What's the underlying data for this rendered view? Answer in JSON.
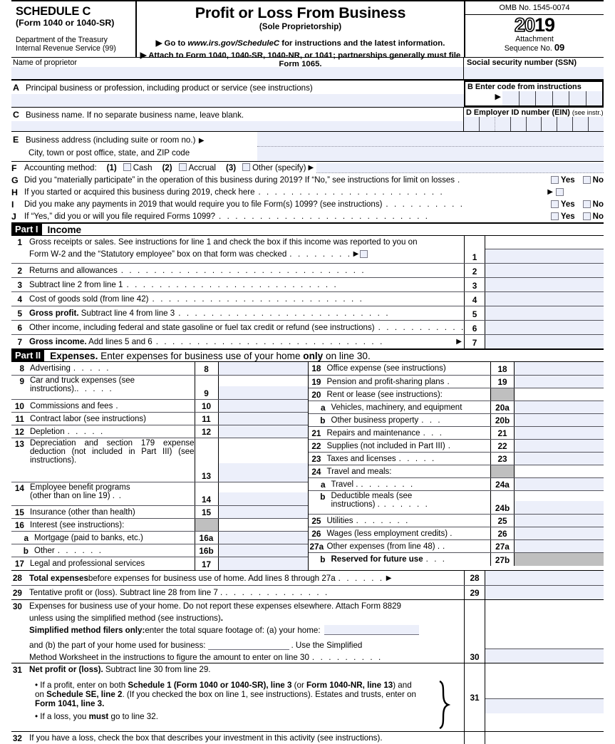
{
  "header": {
    "schedule": "SCHEDULE C",
    "schedule_sub": "(Form 1040 or 1040-SR)",
    "dept_line1": "Department of the Treasury",
    "dept_line2": "Internal Revenue Service (99)",
    "title": "Profit or Loss From Business",
    "subtitle": "(Sole Proprietorship)",
    "goto_prefix": "▶ Go to ",
    "goto_url": "www.irs.gov/ScheduleC",
    "goto_suffix": " for instructions and the latest information.",
    "attach": "▶ Attach to Form 1040, 1040-SR, 1040-NR, or 1041; partnerships generally must file Form 1065.",
    "omb": "OMB No. 1545-0074",
    "year_hollow": "20",
    "year_bold": "19",
    "attachment_label": "Attachment",
    "sequence_label": "Sequence No.",
    "sequence_no": "09"
  },
  "identity": {
    "name_label": "Name of proprietor",
    "name_value": "",
    "ssn_label": "Social security number (SSN)",
    "ssn_value": "",
    "a_letter": "A",
    "a_label": "Principal business or profession, including product or service (see instructions)",
    "a_value": "",
    "b_letter": "B",
    "b_label": "Enter code from instructions",
    "b_cells": 6,
    "c_letter": "C",
    "c_label": "Business name. If no separate business name, leave blank.",
    "c_value": "",
    "d_letter": "D",
    "d_label": "Employer ID number (EIN)",
    "d_label_note": "(see instr.)",
    "d_cells": 9,
    "e_letter": "E",
    "e_label": "Business address (including suite or room no.)",
    "e_value": "",
    "e_label2": "City, town or post office, state, and ZIP code",
    "e_value2": ""
  },
  "questions": {
    "f_letter": "F",
    "f_label": "Accounting method:",
    "f_options": [
      {
        "num": "(1)",
        "label": "Cash"
      },
      {
        "num": "(2)",
        "label": "Accrual"
      },
      {
        "num": "(3)",
        "label": "Other (specify)"
      }
    ],
    "f_other_value": "",
    "g_letter": "G",
    "g_text": "Did you “materially participate” in the operation of this business during 2019? If “No,” see instructions for limit on losses",
    "h_letter": "H",
    "h_text": "If you started or acquired this business during 2019, check here",
    "i_letter": "I",
    "i_text": "Did you make any payments in 2019 that would require you to file Form(s) 1099? (see instructions)",
    "j_letter": "J",
    "j_text": "If “Yes,” did you or will you file required Forms 1099?",
    "yes_label": "Yes",
    "no_label": "No"
  },
  "part1": {
    "part_label": "Part I",
    "part_title": "Income",
    "lines": [
      {
        "no": "1",
        "text_plain": "Gross receipts or sales. See instructions for line 1 and check the box if this income was reported to you on",
        "text2": "Form W-2 and the “Statutory employee” box on that form was checked",
        "box_no": "1",
        "amount": ""
      },
      {
        "no": "2",
        "text_plain": "Returns and allowances",
        "box_no": "2",
        "amount": ""
      },
      {
        "no": "3",
        "text_plain": "Subtract line 2 from line 1",
        "box_no": "3",
        "amount": ""
      },
      {
        "no": "4",
        "text_plain": "Cost of goods sold (from line 42)",
        "box_no": "4",
        "amount": ""
      },
      {
        "no": "5",
        "bold": "Gross profit.",
        "text_plain": " Subtract line 4 from line 3",
        "box_no": "5",
        "amount": ""
      },
      {
        "no": "6",
        "text_plain": "Other income, including federal and state gasoline or fuel tax credit or refund (see instructions)",
        "box_no": "6",
        "amount": ""
      },
      {
        "no": "7",
        "bold": "Gross income.",
        "text_plain": " Add lines 5 and 6",
        "box_no": "7",
        "amount": ""
      }
    ]
  },
  "part2": {
    "part_label": "Part II",
    "part_title_bold": "Expenses.",
    "part_title_rest": " Enter expenses for business use of your home ",
    "part_title_only": "only",
    "part_title_end": " on line 30.",
    "left_lines": [
      {
        "no": "8",
        "label": "Advertising",
        "box_no": "8",
        "amount": "",
        "dots": ".  .  .  .  ."
      },
      {
        "no": "9",
        "label": "Car and truck expenses (see",
        "label2": "instructions).",
        "box_no": "9",
        "amount": "",
        "dots": ".  .  .  .  ."
      },
      {
        "no": "10",
        "label": "Commissions and fees",
        "box_no": "10",
        "amount": "",
        "dots": "  ."
      },
      {
        "no": "11",
        "label": "Contract labor (see instructions)",
        "box_no": "11",
        "amount": "",
        "dots": ""
      },
      {
        "no": "12",
        "label": "Depletion",
        "box_no": "12",
        "amount": "",
        "dots": ".  .  .  .  ."
      },
      {
        "no": "13",
        "label": "Depreciation and section 179 expense deduction (not included in Part III) (see instructions).",
        "box_no": "13",
        "amount": "",
        "dots": "  .  .  .  .  ."
      },
      {
        "no": "14",
        "label": "Employee benefit programs",
        "label2": "(other than on line 19) .",
        "box_no": "14",
        "amount": "",
        "dots": "  ."
      },
      {
        "no": "15",
        "label": "Insurance (other than health)",
        "box_no": "15",
        "amount": "",
        "dots": ""
      },
      {
        "no": "16",
        "label": "Interest (see instructions):",
        "box_no": "",
        "shaded": true
      },
      {
        "no": "a",
        "label": "Mortgage (paid to banks, etc.)",
        "box_no": "16a",
        "amount": "",
        "dots": ""
      },
      {
        "no": "b",
        "label": "Other",
        "box_no": "16b",
        "amount": "",
        "dots": ".  .  .  .  .  ."
      },
      {
        "no": "17",
        "label": "Legal and professional services",
        "box_no": "17",
        "amount": "",
        "dots": ""
      }
    ],
    "right_lines": [
      {
        "no": "18",
        "label": "Office expense (see instructions)",
        "box_no": "18",
        "amount": "",
        "dots": ""
      },
      {
        "no": "19",
        "label": "Pension and profit-sharing plans",
        "box_no": "19",
        "amount": "",
        "dots": "  ."
      },
      {
        "no": "20",
        "label": "Rent or lease (see instructions):",
        "box_no": "",
        "shaded": true
      },
      {
        "no": "a",
        "label": "Vehicles, machinery, and equipment",
        "box_no": "20a",
        "amount": "",
        "dots": ""
      },
      {
        "no": "b",
        "label": "Other business property",
        "box_no": "20b",
        "amount": "",
        "dots": "  .  .  ."
      },
      {
        "no": "21",
        "label": "Repairs and maintenance",
        "box_no": "21",
        "amount": "",
        "dots": "  .  .  ."
      },
      {
        "no": "22",
        "label": "Supplies (not included in Part III)",
        "box_no": "22",
        "amount": "",
        "dots": "  ."
      },
      {
        "no": "23",
        "label": "Taxes and licenses",
        "box_no": "23",
        "amount": "",
        "dots": ".  .  .  .  ."
      },
      {
        "no": "24",
        "label": "Travel and meals:",
        "box_no": "",
        "shaded": true
      },
      {
        "no": "a",
        "label": "Travel .",
        "box_no": "24a",
        "amount": "",
        "dots": "  .  .  .  .  .  .  ."
      },
      {
        "no": "b",
        "label": "Deductible meals (see",
        "label2": "instructions) .",
        "box_no": "24b",
        "amount": "",
        "dots": "  .  .  .  .  .  ."
      },
      {
        "no": "25",
        "label": "Utilities",
        "box_no": "25",
        "amount": "",
        "dots": "  .  .  .  .  .  .  ."
      },
      {
        "no": "26",
        "label": "Wages (less employment credits) .",
        "box_no": "26",
        "amount": "",
        "dots": ""
      },
      {
        "no": "27a",
        "label": "Other expenses (from line 48) .",
        "box_no": "27a",
        "amount": "",
        "dots": "  ."
      },
      {
        "no": "b",
        "label_bold": "Reserved for future use",
        "box_no": "27b",
        "amount": "",
        "shaded_amount": true,
        "dots": "  .  .  ."
      }
    ]
  },
  "bottom": {
    "line28": {
      "no": "28",
      "bold": "Total expenses",
      "text": " before expenses for business use of home. Add lines 8 through 27a",
      "dots": " .  .  .  .  .  .",
      "box_no": "28",
      "amount": ""
    },
    "line29": {
      "no": "29",
      "text": "Tentative profit or (loss). Subtract line 28 from line 7 .",
      "dots": "  .  .  .  .  .  .  .  .  .  .  .  .  .",
      "box_no": "29",
      "amount": ""
    },
    "line30": {
      "no": "30",
      "text1": "Expenses for business use of your home. Do not report these expenses elsewhere. Attach Form 8829",
      "text2": "unless using the simplified method (see instructions)",
      "text2_end": ".",
      "simplified_bold": "Simplified method filers only:",
      "simplified_rest": " enter the total square footage of: (a) your home:",
      "home_value": "",
      "text3": "and (b) the part of your home used for business:",
      "business_value": "",
      "text3_end": ". Use the Simplified",
      "text4": "Method Worksheet in the instructions to figure the amount to enter on line 30",
      "dots4": "  .  .  .  .  .  .  .  .  .",
      "box_no": "30",
      "amount": ""
    },
    "line31": {
      "no": "31",
      "bold": "Net profit or (loss).",
      "text": " Subtract line 30 from line 29.",
      "bullet1_a": "•  If a profit, enter on both ",
      "bullet1_b1": "Schedule 1 (Form 1040 or 1040-SR), line 3",
      "bullet1_b2": " (or ",
      "bullet1_b3": "Form 1040-NR, line",
      "bullet1_c1": "13",
      "bullet1_c2": ") and on ",
      "bullet1_c3": "Schedule SE, line 2",
      "bullet1_c4": ". (If you checked the box on line 1, see instructions). Estates and",
      "bullet1_d1": "trusts, enter on ",
      "bullet1_d2": "Form 1041, line 3.",
      "bullet2_a": "•  If a loss, you ",
      "bullet2_b": "must",
      "bullet2_c": "  go to line 32.",
      "box_no": "31",
      "amount": ""
    },
    "line32": {
      "no": "32",
      "text": "If you have a loss, check the box that describes your investment in this activity (see instructions)."
    }
  },
  "colors": {
    "field_fill": "#eceffa",
    "shaded_fill": "#bfbfbf",
    "rule": "#000000"
  }
}
